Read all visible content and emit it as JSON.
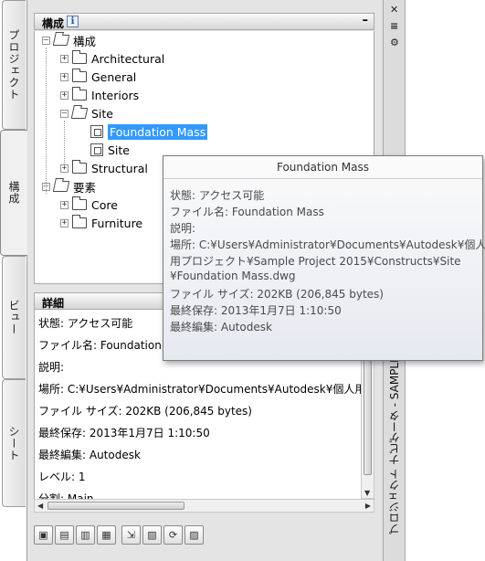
{
  "left_tabs": [
    {
      "label": "プロジェクト"
    },
    {
      "label": "構成"
    },
    {
      "label": "ビュー"
    },
    {
      "label": "シート"
    }
  ],
  "tree_panel": {
    "title": "構成",
    "info_icon": "i",
    "collapse": "–"
  },
  "tree": [
    {
      "label": "構成",
      "indent": 0,
      "expander": "–",
      "icon": "folder-open-icon"
    },
    {
      "label": "Architectural",
      "indent": 1,
      "expander": "+",
      "icon": "folder-icon"
    },
    {
      "label": "General",
      "indent": 1,
      "expander": "+",
      "icon": "folder-icon"
    },
    {
      "label": "Interiors",
      "indent": 1,
      "expander": "+",
      "icon": "folder-icon"
    },
    {
      "label": "Site",
      "indent": 1,
      "expander": "–",
      "icon": "folder-open-icon"
    },
    {
      "label": "Foundation Mass",
      "indent": 2,
      "expander": "",
      "icon": "drawing-icon",
      "selected": true
    },
    {
      "label": "Site",
      "indent": 2,
      "expander": "",
      "icon": "drawing-icon"
    },
    {
      "label": "Structural",
      "indent": 1,
      "expander": "+",
      "icon": "folder-icon"
    },
    {
      "label": "要素",
      "indent": 0,
      "expander": "–",
      "icon": "folder-open-icon"
    },
    {
      "label": "Core",
      "indent": 1,
      "expander": "+",
      "icon": "folder-icon"
    },
    {
      "label": "Furniture",
      "indent": 1,
      "expander": "+",
      "icon": "folder-icon"
    }
  ],
  "detail_panel": {
    "title": "詳細",
    "lines": [
      "状態: アクセス可能",
      "ファイル名: Foundation",
      "説明:",
      "場所: C:¥Users¥Administrator¥Documents¥Autodesk¥個人用プ",
      "ファイル サイズ: 202KB (206,845 bytes)",
      "最終保存: 2013年1月7日  1:10:50",
      "最終編集: Autodesk",
      "レベル: 1",
      "分割: Main"
    ]
  },
  "tooltip": {
    "title": "Foundation Mass",
    "lines": [
      "状態: アクセス可能",
      "ファイル名: Foundation Mass",
      "説明:",
      "場所: C:¥Users¥Administrator¥Documents¥Autodesk¥個人",
      "用プロジェクト¥Sample Project 2015¥Constructs¥Site",
      "¥Foundation Mass.dwg",
      "ファイル サイズ: 202KB (206,845 bytes)",
      "最終保存: 2013年1月7日  1:10:50",
      "最終編集: Autodesk"
    ]
  },
  "right_strip": {
    "close": "✕",
    "pin": "≡",
    "settings": "⚙",
    "title": "プロジェクト ナビゲータ - SAMPLE"
  },
  "toolbar": [
    {
      "name": "add-component-button",
      "glyph": "▣"
    },
    {
      "name": "add-element-button",
      "glyph": "▤"
    },
    {
      "name": "add-construct-button",
      "glyph": "▥"
    },
    {
      "name": "open-button",
      "glyph": "▦"
    },
    {
      "name": "select-button",
      "glyph": "⇲"
    },
    {
      "name": "properties-button",
      "glyph": "▧"
    },
    {
      "name": "refresh-button",
      "glyph": "⟳"
    },
    {
      "name": "repath-button",
      "glyph": "▨"
    }
  ]
}
